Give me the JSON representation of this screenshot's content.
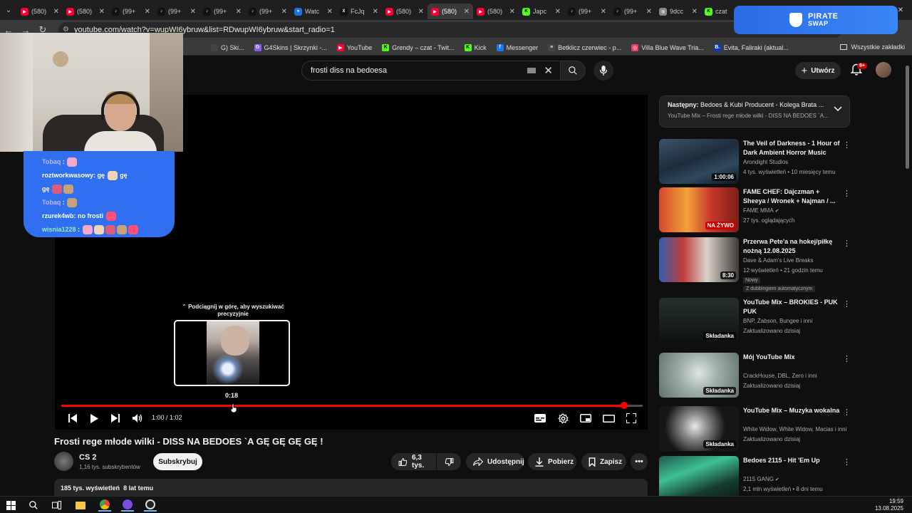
{
  "browser": {
    "tabs": [
      {
        "label": "(580)",
        "icon": "youtube-icon",
        "color": "#ff0033"
      },
      {
        "label": "(580)",
        "icon": "youtube-icon",
        "color": "#ff0033"
      },
      {
        "label": "(99+",
        "icon": "tiktok-icon",
        "color": "#111111"
      },
      {
        "label": "(99+",
        "icon": "tiktok-icon",
        "color": "#111111"
      },
      {
        "label": "(99+",
        "icon": "tiktok-icon",
        "color": "#111111"
      },
      {
        "label": "(99+",
        "icon": "tiktok-icon",
        "color": "#111111"
      },
      {
        "label": "Watc",
        "icon": "watch-icon",
        "color": "#1a73e8"
      },
      {
        "label": "FcJq",
        "icon": "x-icon",
        "color": "#111111"
      },
      {
        "label": "(580)",
        "icon": "youtube-icon",
        "color": "#ff0033"
      },
      {
        "label": "(580)",
        "icon": "youtube-icon",
        "color": "#ff0033",
        "active": true
      },
      {
        "label": "(580)",
        "icon": "youtube-icon",
        "color": "#ff0033"
      },
      {
        "label": "Japc",
        "icon": "kick-icon",
        "color": "#53fc18"
      },
      {
        "label": "(99+",
        "icon": "tiktok-icon",
        "color": "#111111"
      },
      {
        "label": "(99+",
        "icon": "tiktok-icon",
        "color": "#111111"
      },
      {
        "label": "9dcc",
        "icon": "globe-icon",
        "color": "#888888"
      },
      {
        "label": "czat",
        "icon": "kick-icon",
        "color": "#53fc18"
      }
    ],
    "url": "youtube.com/watch?v=wupWI6ybruw&list=RDwupWI6ybruw&start_radio=1",
    "bookmarks": [
      {
        "label": "G) Ski...",
        "color": "#444444",
        "glyph": ""
      },
      {
        "label": "G4Skins | Skrzynki -...",
        "color": "#8b5cf6",
        "glyph": "G"
      },
      {
        "label": "YouTube",
        "color": "#ff0033",
        "glyph": "▶"
      },
      {
        "label": "Grendy – czat - Twit...",
        "color": "#53fc18",
        "glyph": "K"
      },
      {
        "label": "Kick",
        "color": "#53fc18",
        "glyph": "K"
      },
      {
        "label": "Messenger",
        "color": "#1877f2",
        "glyph": "f"
      },
      {
        "label": "Betklicz czerwiec - p...",
        "color": "#444444",
        "glyph": "≡"
      },
      {
        "label": "Villa Blue Wave Tria...",
        "color": "#e4405f",
        "glyph": "◎"
      },
      {
        "label": "Evita, Faliraki (aktual...",
        "color": "#0b3bbd",
        "glyph": "B."
      }
    ],
    "all_bookmarks": "Wszystkie zakładki"
  },
  "ad": {
    "line1": "PIRATE",
    "line2": "SWAP"
  },
  "youtube": {
    "search_value": "frosti diss na bedoesa",
    "create_label": "Utwórz",
    "notif_count": "9+"
  },
  "player": {
    "preview_tip": "⌃ Podciągnij w górę, aby wyszukiwać precyzyjnie",
    "preview_time": "0:18",
    "time_display": "1:00 / 1:02",
    "progress": 0.9677,
    "hover_fraction": 0.295
  },
  "chat": [
    {
      "user": "Tobaq",
      "user_color": "purple",
      "text": "",
      "emotes": 1
    },
    {
      "user": "roztworkwasowy",
      "user_color": "white",
      "text": "gę",
      "emotes": 1,
      "tail": "gę"
    },
    {
      "user": "",
      "user_color": "white",
      "text": "gę",
      "emotes": 2
    },
    {
      "user": "Tobaq",
      "user_color": "purple",
      "text": "",
      "emotes": 1
    },
    {
      "user": "rzurek4wb",
      "user_color": "white",
      "text": "no frosti",
      "emotes": 1
    },
    {
      "user": "wisnia1228",
      "user_color": "green",
      "text": "",
      "emotes": 5
    }
  ],
  "video": {
    "title": "Frosti rege młode wilki - DISS NA BEDOES `A GĘ GĘ GĘ GĘ !",
    "channel": "CS 2",
    "subs": "1,16 tys. subskrybentów",
    "subscribe": "Subskrybuj",
    "likes": "6,3 tys.",
    "share": "Udostępnij",
    "download": "Pobierz",
    "save": "Zapisz",
    "views": "185 tys. wyświetleń",
    "age": "8 lat temu"
  },
  "sidebar": {
    "next_label": "Następny:",
    "next_title": "Bedoes & Kubi Producent - Kolega Brata ...",
    "next_sub": "YouTube Mix – Frosti rege młode wilki - DISS NA BEDOES `A...",
    "recs": [
      {
        "title": "The Veil of Darkness - 1 Hour of Dark Ambient Horror Music",
        "channel": "Arondight Studios",
        "verified": false,
        "meta": "4 tys. wyświetleń • 10 miesięcy temu",
        "badge": "1:00:06",
        "badge_type": "time",
        "thumb": "linear-gradient(160deg,#3b5468 0%,#1d2c3a 45%,#2f4a5e 70%,#0e161e 100%)"
      },
      {
        "title": "FAME CHEF: Dajczman + Sheeya / Wronek + Najman / ...",
        "channel": "FAME MMA",
        "verified": true,
        "meta": "27 tys. oglądających",
        "badge": "NA ŻYWO",
        "badge_type": "live",
        "thumb": "linear-gradient(90deg,#d6452c 0%,#f0a33a 35%,#c8362a 65%,#7a2018 100%)"
      },
      {
        "title": "Przerwa Pete'a na hokej/piłkę nożną 12.08.2025",
        "channel": "Dave & Adam's Live Breaks",
        "verified": false,
        "meta": "12 wyświetleń • 21 godzin temu",
        "badge": "8:30",
        "badge_type": "time",
        "new": "Nowy",
        "dub": "Z dubbingiem automatycznym",
        "thumb": "linear-gradient(90deg,#2f5fae 0%,#c23b3b 30%,#d9d2c8 60%,#3d3a38 100%)"
      },
      {
        "title": "YouTube Mix – BROKIES - PUK PUK",
        "channel": "BNP, Żabson, Bungee i inni",
        "verified": false,
        "meta": "Zaktualizowano dzisiaj",
        "badge": "Składanka",
        "badge_type": "mix",
        "thumb": "linear-gradient(180deg,#26302a 0%,#1b221d 50%,#0d110e 100%)"
      },
      {
        "title": "Mój YouTube Mix",
        "channel": "CrackHouse, DBL, Zero i inni",
        "verified": false,
        "meta": "Zaktualizowano dzisiaj",
        "badge": "Składanka",
        "badge_type": "mix",
        "thumb": "radial-gradient(circle at 50% 45%,#dfe6e2 0%,#9fb0a9 40%,#5f716b 100%)"
      },
      {
        "title": "YouTube Mix – Muzyka wokalna",
        "channel": "White Widow, White Widow, Macias i inni",
        "verified": false,
        "meta": "Zaktualizowano dzisiaj",
        "badge": "Składanka",
        "badge_type": "mix",
        "thumb": "radial-gradient(circle at 45% 45%,#e8e8e8 0%,#8a8a8a 25%,#161616 60%)"
      },
      {
        "title": "Bedoes 2115 - Hit 'Em Up",
        "channel": "2115 GANG",
        "verified": true,
        "meta": "2,1 mln wyświetleń • 8 dni temu",
        "badge": "",
        "badge_type": "time",
        "thumb": "linear-gradient(160deg,#1e5a4a 0%,#3fbf95 35%,#153b31 70%,#0a1a16 100%)"
      }
    ]
  },
  "taskbar": {
    "time": "19:59",
    "date": "13.08.2025"
  }
}
